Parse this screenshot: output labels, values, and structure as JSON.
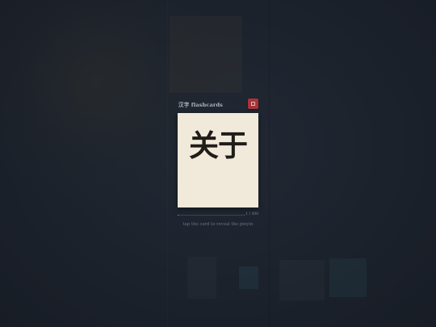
{
  "app": {
    "title": "汉字 flashcards",
    "deck_button_icon": "deck-icon"
  },
  "card": {
    "character": "关于"
  },
  "progress": {
    "current": 1,
    "total": 300,
    "counter_text": "1 / 300"
  },
  "hint": {
    "text": "tap the card to reveal the pinyin"
  },
  "colors": {
    "background": "#1b212c",
    "card": "#f1e9da",
    "accent": "#a5343b"
  }
}
